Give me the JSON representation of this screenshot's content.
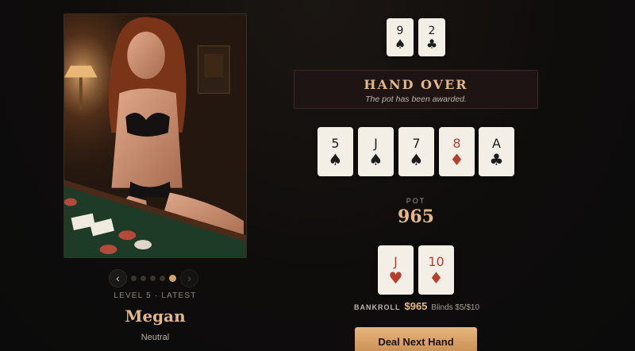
{
  "character": {
    "level_label": "LEVEL 5 · LATEST",
    "name": "Megan",
    "mood": "Neutral",
    "portrait_icon": "character-portrait",
    "carousel": {
      "total": 5,
      "active_index": 4,
      "prev_glyph": "‹",
      "next_glyph": "›"
    }
  },
  "opponent_cards": [
    {
      "rank": "9",
      "suit": "♠",
      "color": "black"
    },
    {
      "rank": "2",
      "suit": "♣",
      "color": "black"
    }
  ],
  "status": {
    "title": "HAND OVER",
    "subtitle": "The pot has been awarded."
  },
  "community_cards": [
    {
      "rank": "5",
      "suit": "♠",
      "color": "black"
    },
    {
      "rank": "J",
      "suit": "♠",
      "color": "black"
    },
    {
      "rank": "7",
      "suit": "♠",
      "color": "black"
    },
    {
      "rank": "8",
      "suit": "♦",
      "color": "red"
    },
    {
      "rank": "A",
      "suit": "♣",
      "color": "black"
    }
  ],
  "pot": {
    "label": "POT",
    "value": "965"
  },
  "player_cards": [
    {
      "rank": "J",
      "suit": "♥",
      "color": "red"
    },
    {
      "rank": "10",
      "suit": "♦",
      "color": "red"
    }
  ],
  "bankroll": {
    "label": "BANKROLL",
    "value": "$965",
    "blinds": "Blinds $5/$10"
  },
  "actions": {
    "deal_label": "Deal Next Hand"
  },
  "colors": {
    "accent": "#e2b889",
    "card_face": "#f3efe6",
    "red_suit": "#b5402f",
    "button": "#d9a068"
  }
}
